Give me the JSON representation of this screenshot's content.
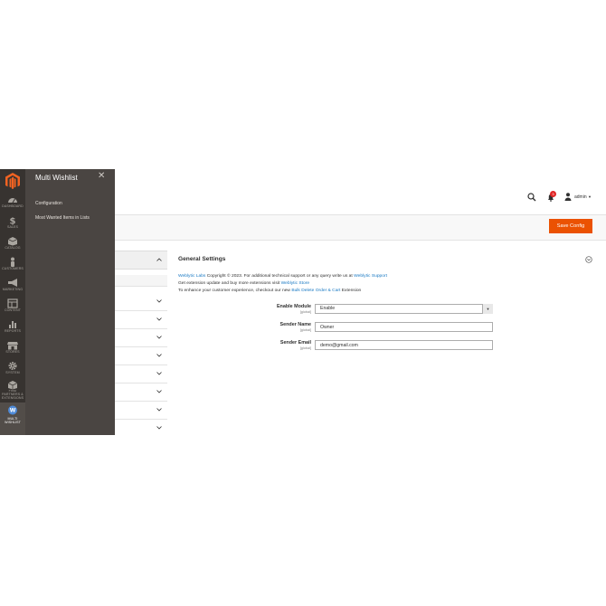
{
  "adminbar": {
    "items": [
      {
        "label": "DASHBOARD",
        "icon": "dashboard-icon"
      },
      {
        "label": "SALES",
        "icon": "dollar-icon"
      },
      {
        "label": "CATALOG",
        "icon": "box-icon"
      },
      {
        "label": "CUSTOMERS",
        "icon": "person-icon"
      },
      {
        "label": "MARKETING",
        "icon": "megaphone-icon"
      },
      {
        "label": "CONTENT",
        "icon": "layout-icon"
      },
      {
        "label": "REPORTS",
        "icon": "bar-chart-icon"
      },
      {
        "label": "STORES",
        "icon": "storefront-icon"
      },
      {
        "label": "SYSTEM",
        "icon": "gear-icon"
      },
      {
        "label": "FIND PARTNERS & EXTENSIONS",
        "icon": "extensions-box-icon"
      },
      {
        "label": "MULTI WISHLIST",
        "icon": "weblytic-logo-icon"
      }
    ]
  },
  "flyout": {
    "title": "Multi Wishlist",
    "links": [
      "Configuration",
      "Most Wanted Items in Lists"
    ]
  },
  "header": {
    "user": "admin",
    "notification_count": "3"
  },
  "actions": {
    "save_label": "Save Config"
  },
  "section": {
    "title": "General Settings",
    "line1": {
      "link1": "Weblytic Labs",
      "text1": " Copyright © 2023. For additional technical support or any query write us at ",
      "link2": "Weblytic Support"
    },
    "line2": {
      "text1": "Get extension update and buy more extensions visit ",
      "link1": "Weblytic Store"
    },
    "line3": {
      "text1": "To enhance your customer experience, checkout our new ",
      "link1": "Bulk Delete Order & Cart",
      "text2": " Extension"
    }
  },
  "fields": {
    "enable_module": {
      "label": "Enable Module",
      "scope": "[global]",
      "value": "Enable"
    },
    "sender_name": {
      "label": "Sender Name",
      "scope": "[global]",
      "value": "Owner"
    },
    "sender_email": {
      "label": "Sender Email",
      "scope": "[global]",
      "value": "demo@gmail.com"
    }
  },
  "colors": {
    "accent": "#eb5202",
    "adminbar": "#373330",
    "flyout": "#4a4542",
    "link": "#1979c3"
  }
}
